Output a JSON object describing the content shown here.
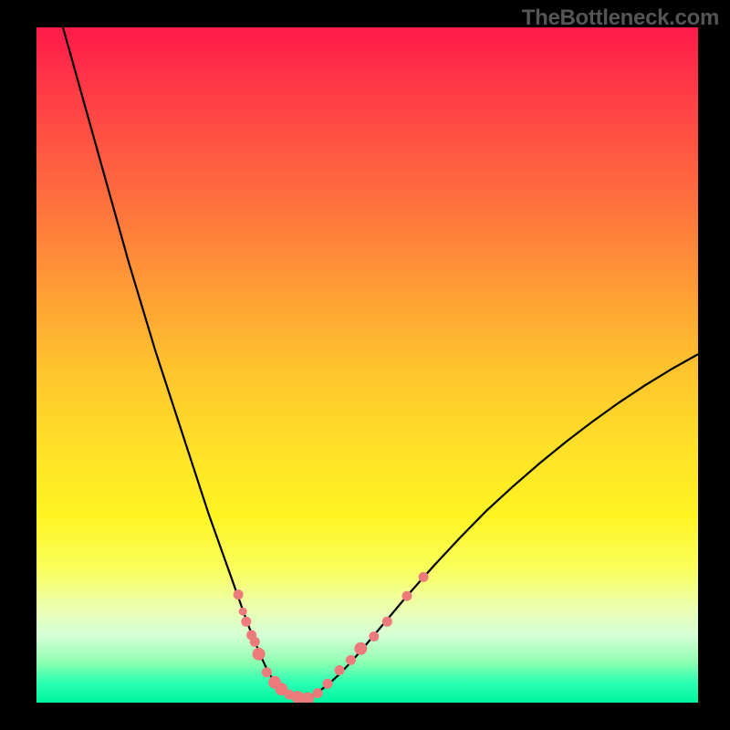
{
  "watermark": "TheBottleneck.com",
  "colors": {
    "frame": "#000000",
    "curve": "#000000",
    "dot": "#ed7b7b"
  },
  "chart_data": {
    "type": "line",
    "title": "",
    "xlabel": "",
    "ylabel": "",
    "xlim": [
      0,
      100
    ],
    "ylim": [
      0,
      100
    ],
    "series": [
      {
        "name": "bottleneck-curve",
        "x": [
          4,
          6,
          8,
          10,
          12,
          14,
          16,
          18,
          20,
          22,
          24,
          26,
          28,
          30,
          31,
          32,
          33,
          34,
          35,
          36,
          37,
          38,
          40,
          42,
          44,
          46,
          48,
          50,
          53,
          56,
          60,
          64,
          68,
          72,
          76,
          80,
          84,
          88,
          92,
          96,
          100
        ],
        "y": [
          100,
          93,
          86,
          79,
          72,
          65,
          58.5,
          52,
          46,
          40,
          34,
          28,
          22.5,
          17,
          14.2,
          11.5,
          9,
          6.7,
          4.6,
          3,
          1.8,
          1,
          0.4,
          1.2,
          2.6,
          4.4,
          6.5,
          8.8,
          12.3,
          15.8,
          20.2,
          24.4,
          28.4,
          32,
          35.4,
          38.6,
          41.6,
          44.4,
          47,
          49.4,
          51.6
        ]
      }
    ],
    "scatter_points": {
      "name": "sample-dots",
      "x": [
        30.5,
        31.2,
        31.7,
        32.5,
        33.0,
        33.6,
        34.8,
        36.0,
        37.0,
        38.2,
        39.5,
        41.0,
        42.5,
        44.0,
        45.8,
        47.5,
        49.0,
        51.0,
        53.0,
        56.0,
        58.5
      ],
      "y": [
        16,
        13.5,
        12,
        10,
        9,
        7.2,
        4.5,
        3,
        2,
        1.2,
        0.8,
        0.6,
        1.4,
        2.8,
        4.8,
        6.3,
        8,
        9.8,
        12,
        15.8,
        18.6
      ],
      "sizes": [
        11,
        9,
        11,
        11,
        11,
        14,
        11,
        14,
        14,
        11,
        14,
        14,
        11,
        11,
        11,
        11,
        14,
        11,
        11,
        11,
        11
      ]
    }
  }
}
